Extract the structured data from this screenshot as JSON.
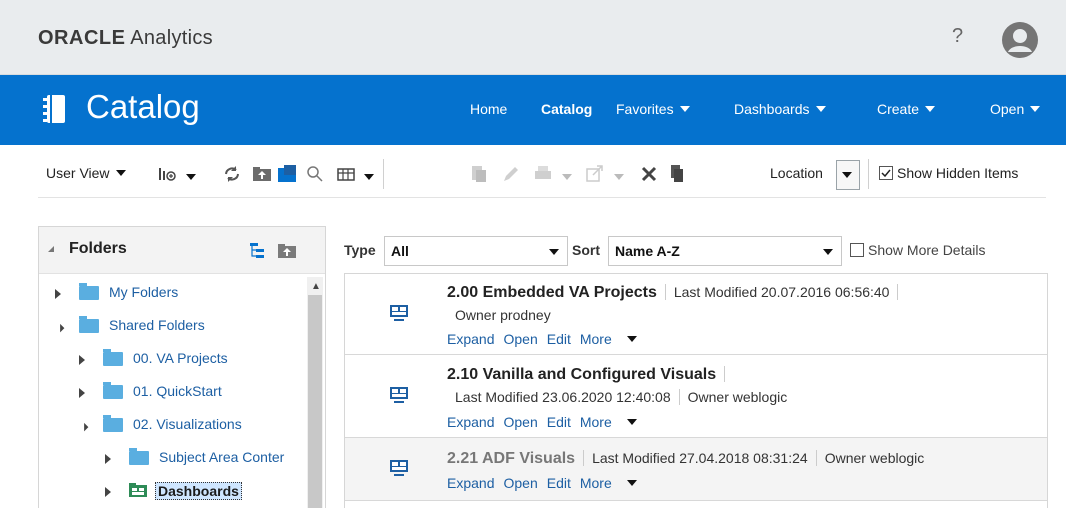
{
  "brand": {
    "name": "ORACLE",
    "product": "Analytics"
  },
  "header": {
    "help": "?"
  },
  "page": {
    "title": "Catalog"
  },
  "nav": [
    {
      "label": "Home",
      "dropdown": false,
      "active": false
    },
    {
      "label": "Catalog",
      "dropdown": false,
      "active": true
    },
    {
      "label": "Favorites",
      "dropdown": true,
      "active": false
    },
    {
      "label": "Dashboards",
      "dropdown": true,
      "active": false
    },
    {
      "label": "Create",
      "dropdown": true,
      "active": false
    },
    {
      "label": "Open",
      "dropdown": true,
      "active": false
    }
  ],
  "toolbar": {
    "user_view": "User View",
    "location": "Location",
    "show_hidden": "Show Hidden Items",
    "show_hidden_checked": true
  },
  "folders": {
    "title": "Folders",
    "items": [
      {
        "label": "My Folders",
        "expanded": false,
        "level": 0
      },
      {
        "label": "Shared Folders",
        "expanded": true,
        "level": 0
      },
      {
        "label": "00. VA Projects",
        "expanded": false,
        "level": 1
      },
      {
        "label": "01. QuickStart",
        "expanded": false,
        "level": 1
      },
      {
        "label": "02. Visualizations",
        "expanded": true,
        "level": 1
      },
      {
        "label": "Subject Area Conter",
        "expanded": false,
        "level": 2
      },
      {
        "label": "Dashboards",
        "expanded": false,
        "level": 2,
        "selected": true
      }
    ]
  },
  "filters": {
    "type_label": "Type",
    "type_value": "All",
    "sort_label": "Sort",
    "sort_value": "Name A-Z",
    "more_details": "Show More Details"
  },
  "items": [
    {
      "name": "2.00 Embedded VA Projects",
      "modified": "Last Modified 20.07.2016 06:56:40",
      "owner": "Owner prodney",
      "actions": [
        "Expand",
        "Open",
        "Edit",
        "More"
      ]
    },
    {
      "name": "2.10 Vanilla and Configured Visuals",
      "modified": "Last Modified 23.06.2020 12:40:08",
      "owner": "Owner weblogic",
      "actions": [
        "Expand",
        "Open",
        "Edit",
        "More"
      ]
    },
    {
      "name": "2.21 ADF Visuals",
      "modified": "Last Modified 27.04.2018 08:31:24",
      "owner": "Owner weblogic",
      "actions": [
        "Expand",
        "Open",
        "Edit",
        "More"
      ]
    }
  ],
  "colors": {
    "header_blue": "#0572ce",
    "link": "#1d5fa3",
    "topbar": "#e9ecee"
  }
}
